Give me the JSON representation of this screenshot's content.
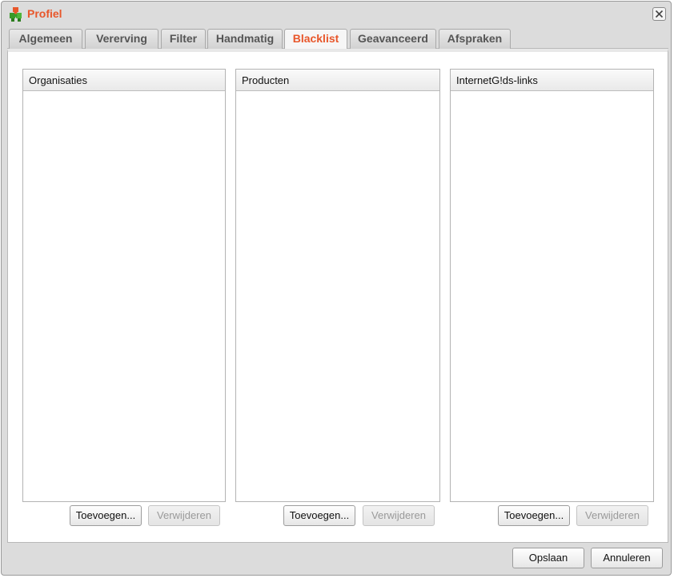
{
  "window": {
    "title": "Profiel"
  },
  "tabs": [
    {
      "label": "Algemeen"
    },
    {
      "label": "Vererving"
    },
    {
      "label": "Filter"
    },
    {
      "label": "Handmatig"
    },
    {
      "label": "Blacklist",
      "active": true
    },
    {
      "label": "Geavanceerd"
    },
    {
      "label": "Afspraken"
    }
  ],
  "lists": [
    {
      "header": "Organisaties",
      "add_label": "Toevoegen...",
      "remove_label": "Verwijderen"
    },
    {
      "header": "Producten",
      "add_label": "Toevoegen...",
      "remove_label": "Verwijderen"
    },
    {
      "header": "InternetG!ds-links",
      "add_label": "Toevoegen...",
      "remove_label": "Verwijderen"
    }
  ],
  "footer": {
    "save_label": "Opslaan",
    "cancel_label": "Annuleren"
  },
  "colors": {
    "accent": "#e8562a",
    "icon_green": "#3a9a2a"
  },
  "icons": {
    "app": "puzzle-icon",
    "close": "close-icon"
  }
}
